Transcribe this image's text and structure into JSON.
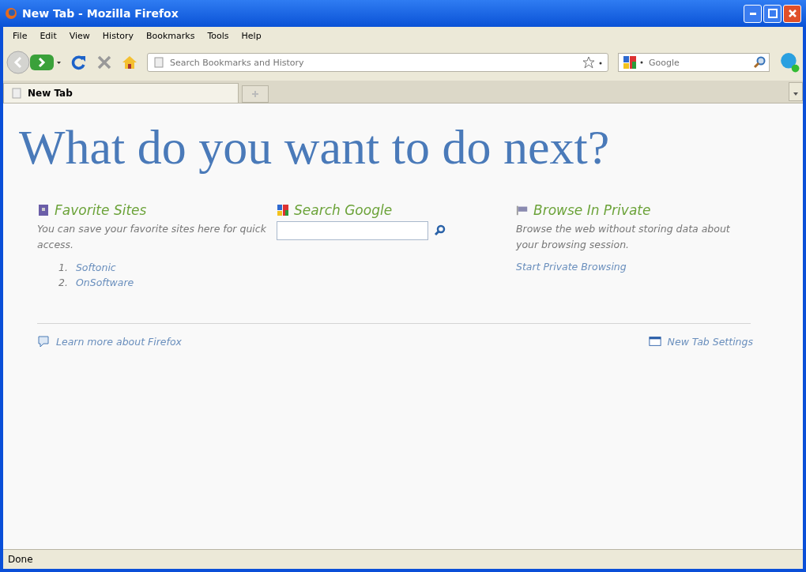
{
  "window": {
    "title": "New Tab - Mozilla Firefox"
  },
  "menu": [
    "File",
    "Edit",
    "View",
    "History",
    "Bookmarks",
    "Tools",
    "Help"
  ],
  "toolbar": {
    "address_placeholder": "Search Bookmarks and History",
    "search_placeholder": "Google"
  },
  "tabs": [
    {
      "label": "New Tab",
      "selected": true
    }
  ],
  "page": {
    "heading": "What do you want to do next?",
    "favorites": {
      "title": "Favorite Sites",
      "description": "You can save your favorite sites here for quick access.",
      "sites": [
        {
          "number": "1.",
          "name": "Softonic"
        },
        {
          "number": "2.",
          "name": "OnSoftware"
        }
      ]
    },
    "search": {
      "title": "Search Google"
    },
    "private": {
      "title": "Browse In Private",
      "description": "Browse the web without storing data about your browsing session.",
      "link": "Start Private Browsing"
    },
    "footer_left": "Learn more about Firefox",
    "footer_right": "New Tab Settings"
  },
  "status_bar": "Done"
}
